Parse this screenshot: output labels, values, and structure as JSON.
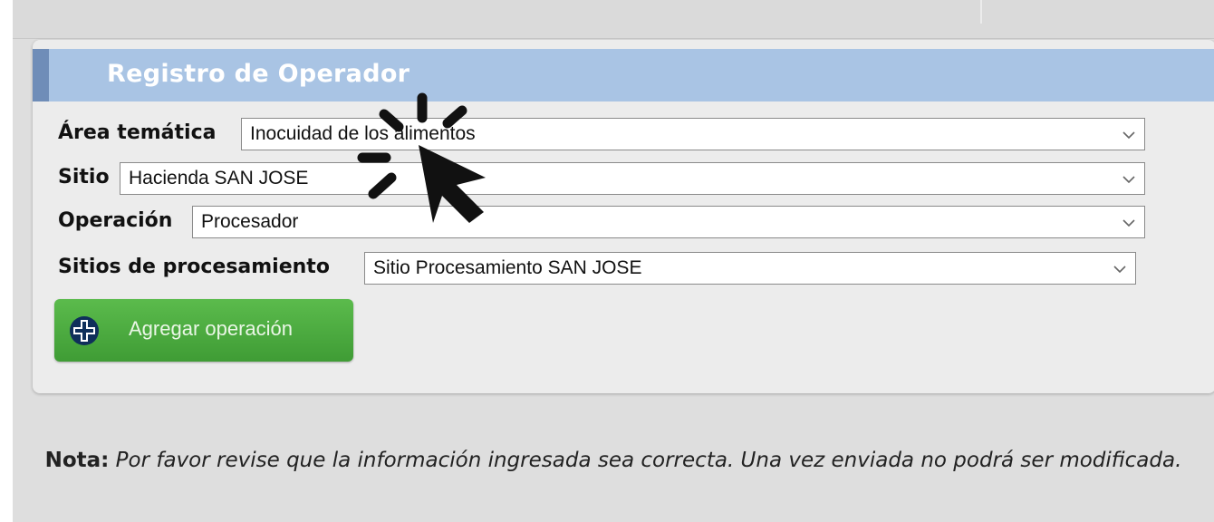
{
  "panel": {
    "title": "Registro de Operador"
  },
  "form": {
    "area": {
      "label": "Área temática",
      "value": "Inocuidad de los alimentos"
    },
    "sitio": {
      "label": "Sitio",
      "value": "Hacienda SAN JOSE"
    },
    "operacion": {
      "label": "Operación",
      "value": "Procesador"
    },
    "sitios_procesamiento": {
      "label": "Sitios de procesamiento",
      "value": "Sitio Procesamiento SAN JOSE"
    }
  },
  "actions": {
    "add_label": "Agregar operación"
  },
  "note": {
    "prefix": "Nota:",
    "text": "Por favor revise que la información ingresada sea correcta. Una vez enviada no podrá ser modificada."
  },
  "colors": {
    "header": "#a9c4e4",
    "header_accent": "#6f8db8",
    "button": "#4aa83e",
    "plus_circle": "#0f2f5a"
  }
}
